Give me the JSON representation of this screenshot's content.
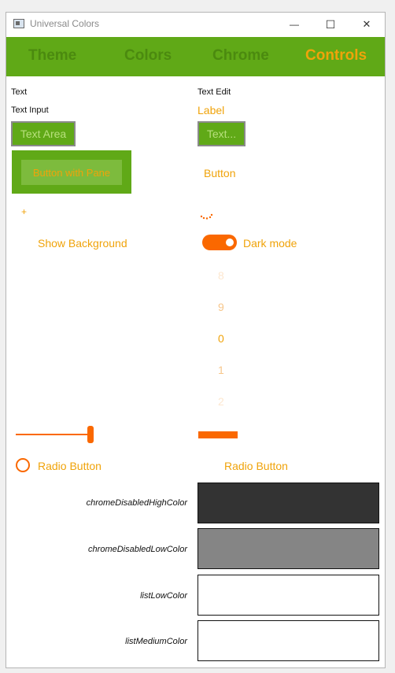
{
  "window": {
    "title": "Universal Colors",
    "controls": {
      "minimize": "—",
      "maximize": "☐",
      "close": "✕"
    }
  },
  "tabs": [
    {
      "label": "Theme",
      "active": false
    },
    {
      "label": "Colors",
      "active": false
    },
    {
      "label": "Chrome",
      "active": false
    },
    {
      "label": "Controls",
      "active": true
    }
  ],
  "controls": {
    "text_label": "Text",
    "text_edit_label": "Text Edit",
    "text_input_label": "Text Input",
    "label_text": "Label",
    "text_area": "Text Area",
    "text_field": "Text...",
    "button_with_pane": "Button with Pane",
    "button": "Button",
    "plus": "+",
    "show_background": "Show Background",
    "dark_mode": "Dark mode",
    "tumbler": [
      "8",
      "9",
      "0",
      "1",
      "2"
    ],
    "tumbler_selected": "0",
    "slider_value": 1.0,
    "progress_value": 1.0,
    "radio_left": "Radio Button",
    "radio_right": "Radio Button"
  },
  "swatches": [
    {
      "name": "chromeDisabledHighColor",
      "color": "#333333"
    },
    {
      "name": "chromeDisabledLowColor",
      "color": "#858585"
    },
    {
      "name": "listLowColor",
      "color": "#ffffff"
    },
    {
      "name": "listMediumColor",
      "color": "#ffffff"
    }
  ],
  "colors": {
    "accent_green": "#60a917",
    "accent_orange": "#f0a30a",
    "control_orange": "#fa6800"
  }
}
